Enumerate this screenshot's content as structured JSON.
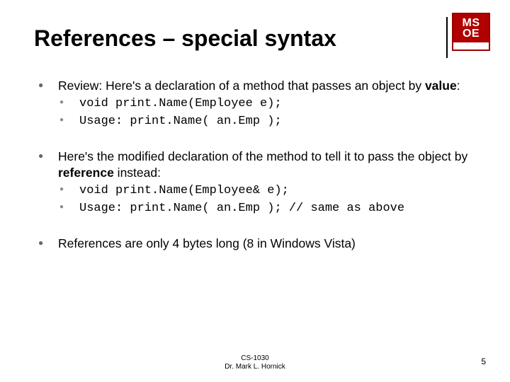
{
  "logo": {
    "line1": "MS",
    "line2": "OE"
  },
  "title": "References – special syntax",
  "bullets": [
    {
      "text_pre": "Review: Here's a declaration of a method that passes an object by ",
      "bold": "value",
      "text_post": ":",
      "sub": [
        "void print.Name(Employee e);",
        "Usage: print.Name( an.Emp );"
      ]
    },
    {
      "text_pre": "Here's the modified declaration of the method to tell it to pass the object by ",
      "bold": "reference",
      "text_post": " instead:",
      "sub": [
        "void print.Name(Employee& e);",
        "Usage: print.Name( an.Emp ); // same as above"
      ]
    },
    {
      "text_pre": "References are only 4 bytes long (8 in Windows Vista)",
      "bold": "",
      "text_post": "",
      "sub": []
    }
  ],
  "footer": {
    "course": "CS-1030",
    "instructor": "Dr. Mark L. Hornick"
  },
  "page_number": "5"
}
